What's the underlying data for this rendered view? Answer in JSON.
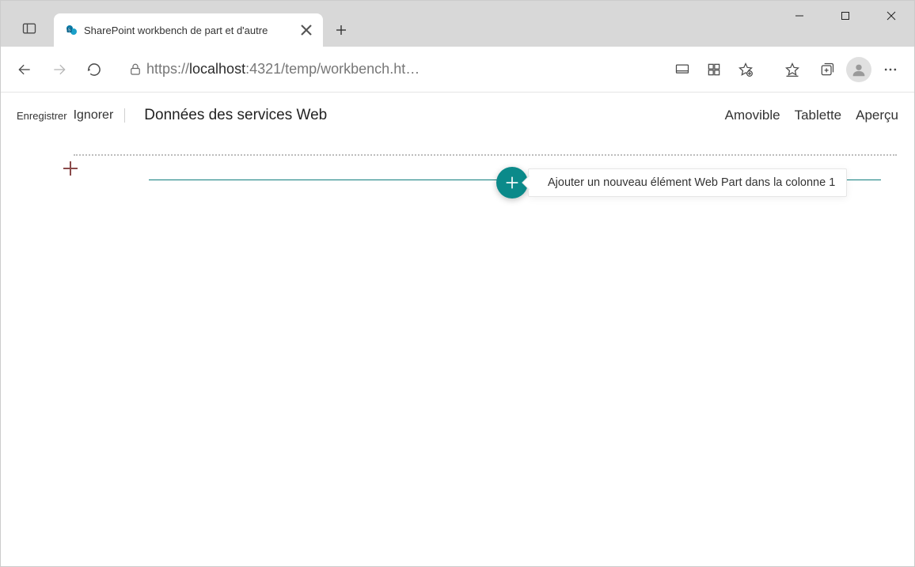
{
  "browser": {
    "tab_title": "SharePoint workbench de part et d'autre",
    "url_proto": "https://",
    "url_host": "localhost",
    "url_port_path": ":4321/temp/workbench.ht…"
  },
  "workbench": {
    "save": "Enregistrer",
    "discard": "Ignorer",
    "title": "Données des services Web",
    "modes": {
      "mobile": "Amovible",
      "tablet": "Tablette",
      "preview": "Aperçu"
    },
    "add_tooltip": "Ajouter un nouveau élément Web Part dans la colonne 1"
  }
}
